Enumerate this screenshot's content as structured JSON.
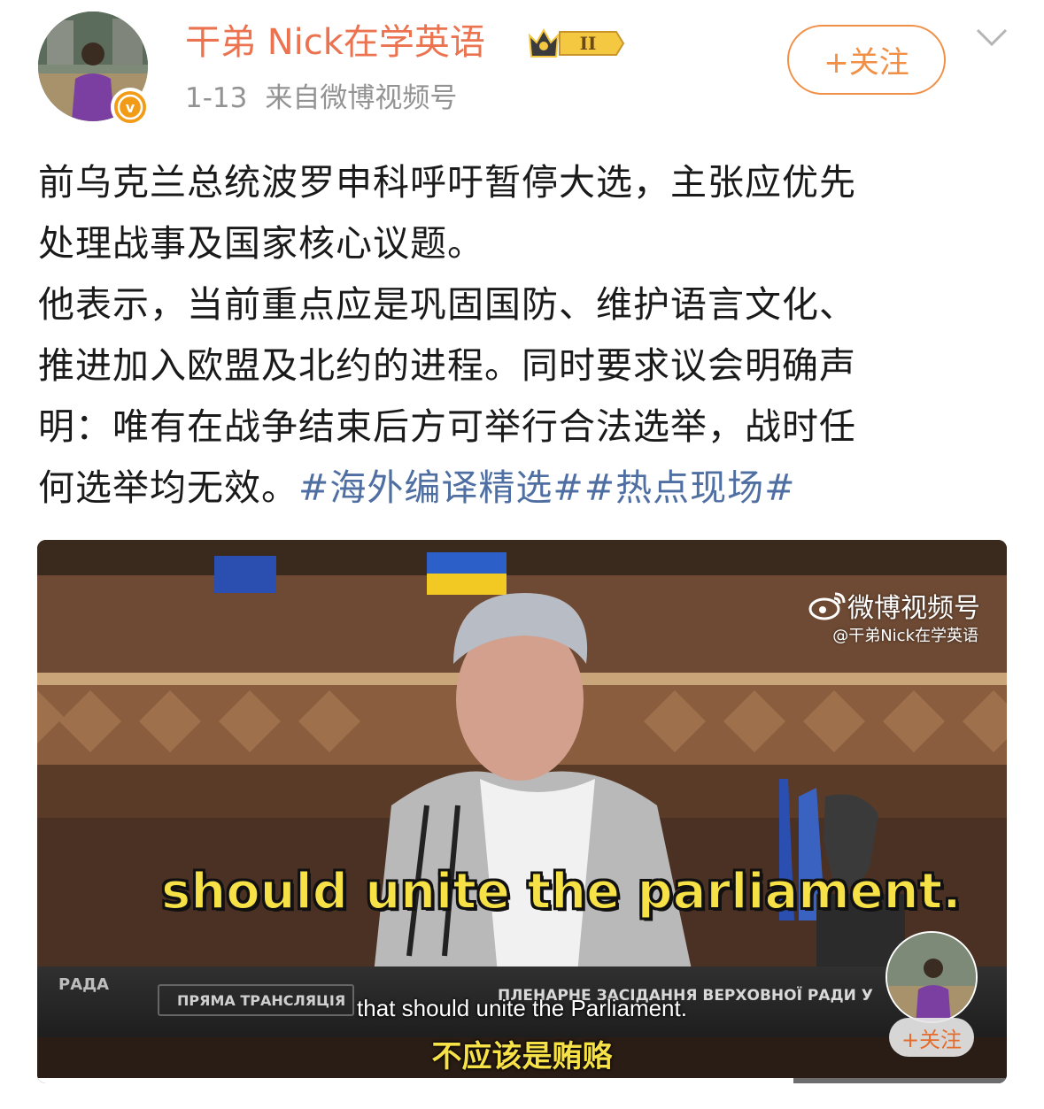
{
  "author": {
    "name": "干弟 Nick在学英语",
    "vip_level": "II",
    "verified_badge": "v"
  },
  "post_meta": {
    "date": "1-13",
    "source": "来自微博视频号"
  },
  "follow_button": {
    "label": "+关注"
  },
  "icons": {
    "menu": "chevron-down-icon",
    "vip": "crown-icon",
    "verified": "verified-icon",
    "weibo": "weibo-logo-icon"
  },
  "post": {
    "lines": [
      "前乌克兰总统波罗申科呼吁暂停大选，主张应优先",
      "处理战事及国家核心议题。",
      "他表示，当前重点应是巩固国防、维护语言文化、",
      "推进加入欧盟及北约的进程。同时要求议会明确声",
      "明：唯有在战争结束后方可举行合法选举，战时任"
    ],
    "last_line_text": "何选举均无效。",
    "hashtags": [
      "#海外编译精选#",
      "#热点现场#"
    ]
  },
  "video": {
    "watermark_brand": "微博视频号",
    "watermark_handle": "@干弟Nick在学英语",
    "big_caption": "should unite the parliament.",
    "channel": "РАДА",
    "live_label": "ПРЯМА ТРАНСЛЯЦІЯ",
    "session_label": "ПЛЕНАРНЕ ЗАСІДАННЯ ВЕРХОВНОЇ РАДИ У",
    "subtitle_en": "that should unite the Parliament.",
    "subtitle_cn": "不应该是贿赂",
    "mini_follow_label": "+关注",
    "progress": 0.78
  },
  "colors": {
    "accent_orange": "#f08f45",
    "name_orange": "#eb7350",
    "hashtag_blue": "#4f6fa3",
    "caption_yellow": "#f6e247"
  }
}
